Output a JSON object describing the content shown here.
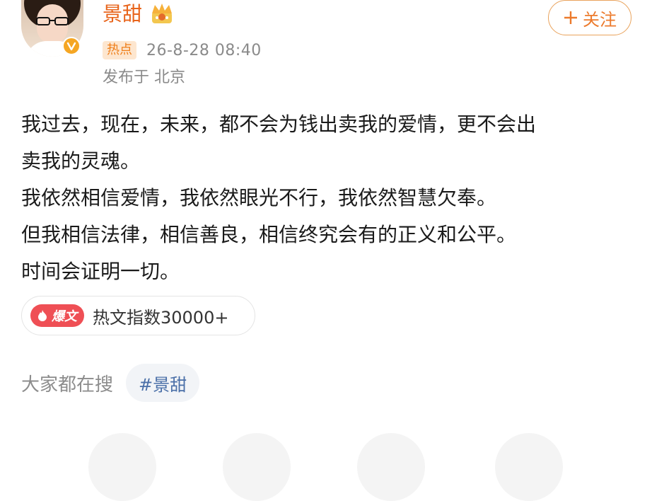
{
  "header": {
    "username": "景甜",
    "user_badge_icon": "crown-icon",
    "verified_icon": "verified-v-icon",
    "follow_label": "关注",
    "follow_icon": "plus-icon",
    "hot_tag": "热点",
    "timestamp": "26-8-28 08:40",
    "location": "发布于 北京"
  },
  "post": {
    "lines": [
      "我过去，现在，未来，都不会为钱出卖我的爱情，更不会出",
      "卖我的灵魂。",
      "我依然相信爱情，我依然眼光不行，我依然智慧欠奉。",
      "但我相信法律，相信善良，相信终究会有的正义和公平。",
      "时间会证明一切。"
    ]
  },
  "hot_index": {
    "badge_label": "爆文",
    "badge_icon": "flame-icon",
    "text": "热文指数30000+"
  },
  "search": {
    "label": "大家都在搜",
    "topic": "#景甜"
  },
  "colors": {
    "accent": "#e8641b",
    "hot_red": "#ef4f55",
    "topic_blue": "#4a6fa8"
  }
}
